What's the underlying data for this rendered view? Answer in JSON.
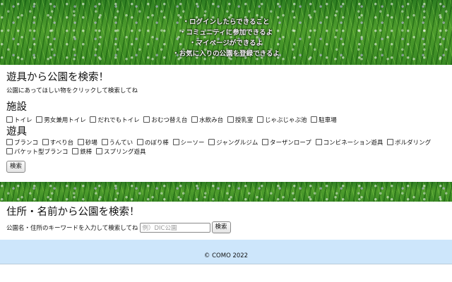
{
  "hero": {
    "features": [
      "ログインしたらできること",
      "コミュニティに参加できるよ",
      "マイページができるよ",
      "お気に入りの公園を登録できるよ"
    ]
  },
  "search": {
    "title": "遊具から公園を検索！",
    "hint": "公園にあってほしい物をクリックして検索してね",
    "facilities": {
      "title": "施設",
      "options": [
        "トイレ",
        "男女兼用トイレ",
        "だれでもトイレ",
        "おむつ替え台",
        "水飲み台",
        "授乳室",
        "じゃぶじゃぶ池",
        "駐車場"
      ]
    },
    "play": {
      "title": "遊具",
      "options": [
        "ブランコ",
        "すべり台",
        "砂場",
        "うんてい",
        "のぼり棒",
        "シーソー",
        "ジャングルジム",
        "ターザンロープ",
        "コンビネーション遊具",
        "ボルダリング",
        "バケット型ブランコ",
        "鉄棒",
        "スプリング遊具"
      ]
    },
    "button_label": "検索"
  },
  "keyword": {
    "title": "住所・名前から公園を検索！",
    "label": "公園名・住所のキーワードを入力して検索してね",
    "placeholder": "例）DIC公園",
    "button_label": "検索"
  },
  "footer": {
    "copyright": "© COMO 2022",
    "background": "#cde6fb"
  },
  "colors": {
    "grass": "#3f8f27",
    "panel": "#ffffff"
  }
}
